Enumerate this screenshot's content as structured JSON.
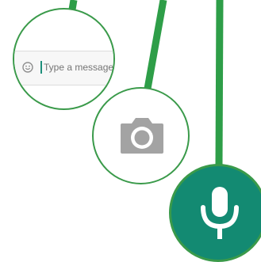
{
  "composer": {
    "placeholder": "Type a message"
  },
  "icons": {
    "emoji": "smiley-icon",
    "camera": "camera-icon",
    "voice": "microphone-icon"
  },
  "colors": {
    "connector": "#2e9e48",
    "bubble_border": "#3a9a4a",
    "mic_button": "#138a72",
    "icon_gray": "#a3a3a3",
    "cursor": "#1e8f7b",
    "placeholder_text": "#b9b9b9"
  }
}
